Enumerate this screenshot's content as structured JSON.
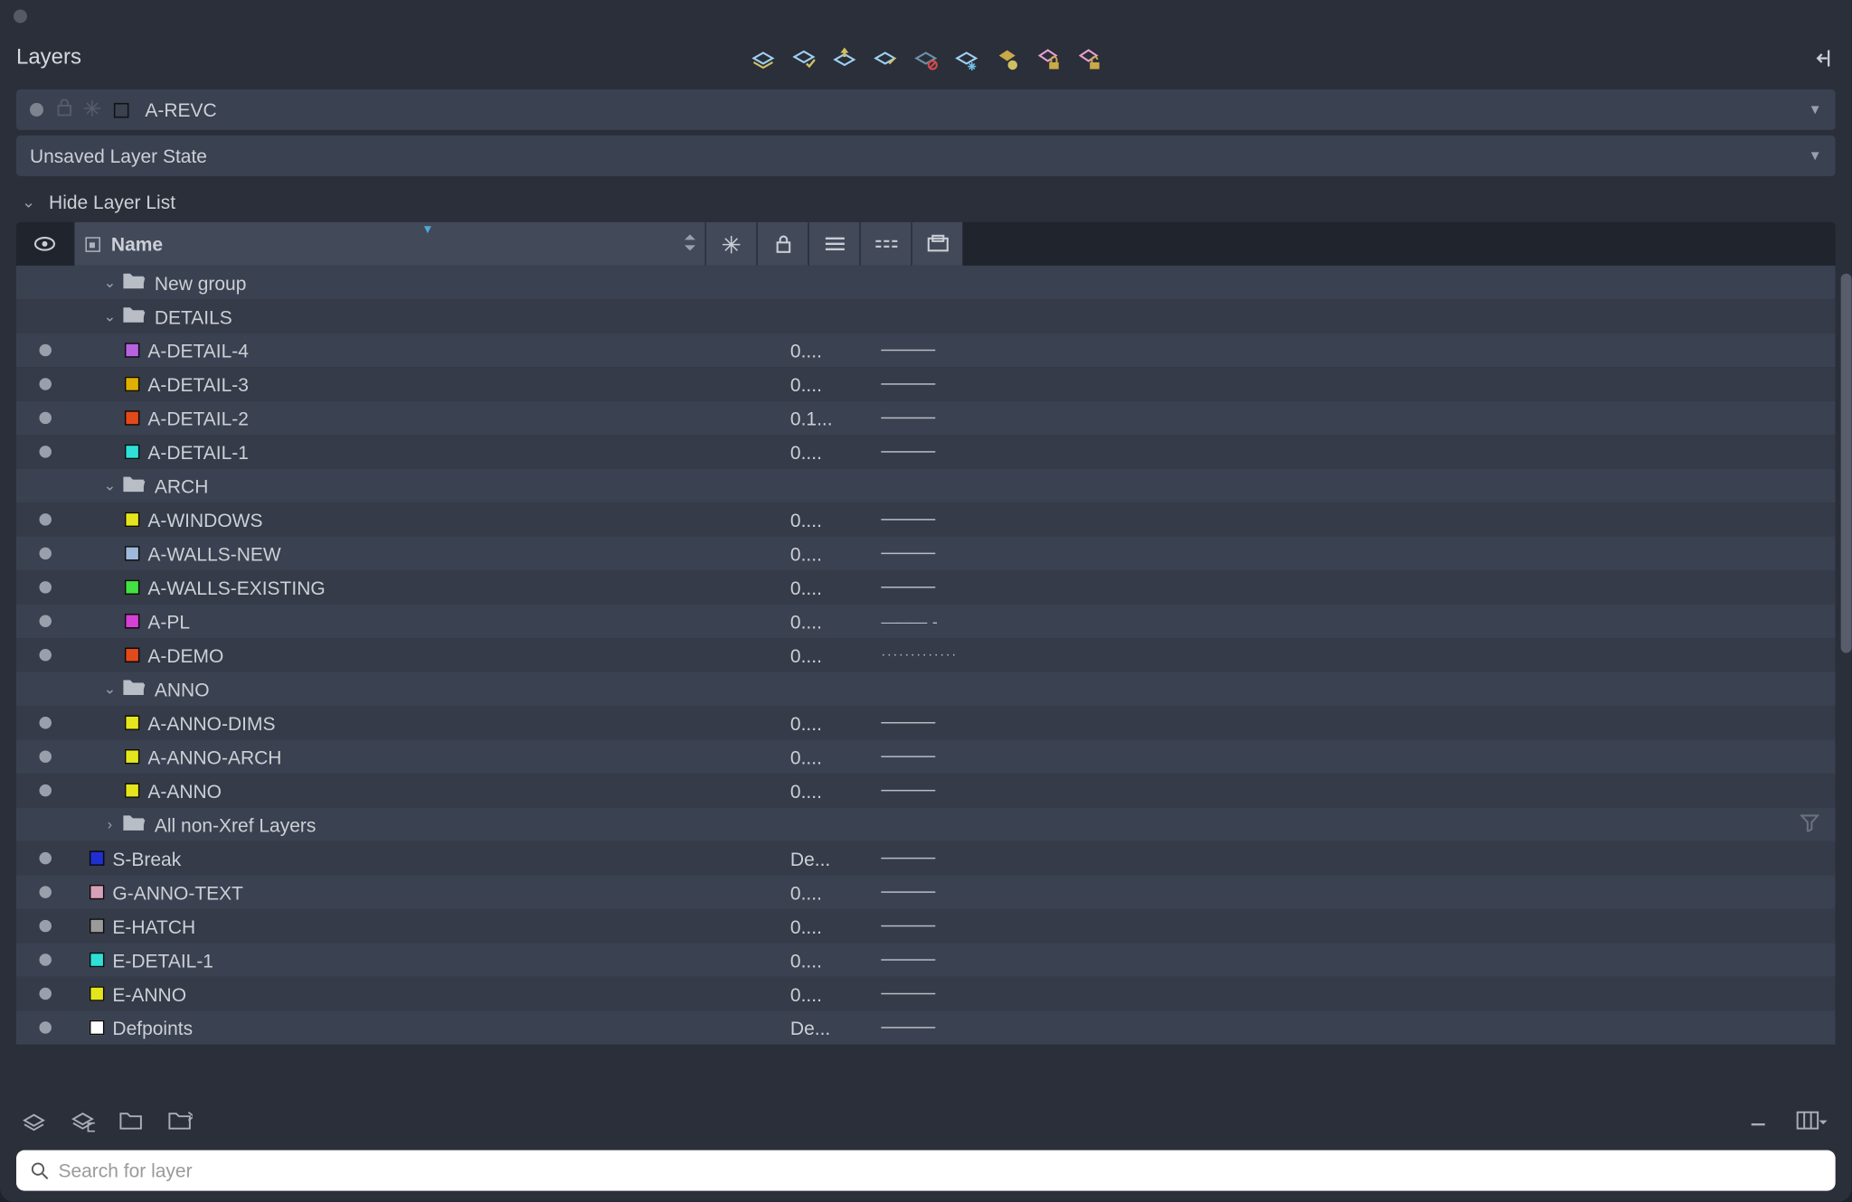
{
  "panel": {
    "title": "Layers",
    "current_layer": {
      "label": "A-REVC",
      "swatch": "#d63fd6"
    },
    "layer_state": "Unsaved Layer State",
    "hide_label": "Hide Layer List",
    "columns": {
      "name": "Name"
    },
    "search_placeholder": "Search for layer"
  },
  "rows": [
    {
      "type": "group",
      "chev": "v",
      "label": "New group",
      "alt": "even"
    },
    {
      "type": "group",
      "chev": "v",
      "label": "DETAILS",
      "alt": "odd"
    },
    {
      "type": "layer",
      "bullet": true,
      "swatch": "#b763e0",
      "label": "A-DETAIL-4",
      "lw": "0....",
      "line": "solid",
      "alt": "even"
    },
    {
      "type": "layer",
      "bullet": true,
      "swatch": "#e0b000",
      "label": "A-DETAIL-3",
      "lw": "0....",
      "line": "solid",
      "alt": "odd"
    },
    {
      "type": "layer",
      "bullet": true,
      "swatch": "#e24a1c",
      "label": "A-DETAIL-2",
      "lw": "0.1...",
      "line": "solid",
      "alt": "even"
    },
    {
      "type": "layer",
      "bullet": true,
      "swatch": "#2fe0d8",
      "label": "A-DETAIL-1",
      "lw": "0....",
      "line": "solid",
      "alt": "odd"
    },
    {
      "type": "group",
      "chev": "v",
      "label": "ARCH",
      "alt": "even"
    },
    {
      "type": "layer",
      "bullet": true,
      "swatch": "#e5e51e",
      "label": "A-WINDOWS",
      "lw": "0....",
      "line": "solid",
      "alt": "odd"
    },
    {
      "type": "layer",
      "bullet": true,
      "swatch": "#9fb9dc",
      "label": "A-WALLS-NEW",
      "lw": "0....",
      "line": "solid",
      "alt": "even"
    },
    {
      "type": "layer",
      "bullet": true,
      "swatch": "#43e043",
      "label": "A-WALLS-EXISTING",
      "lw": "0....",
      "line": "solid",
      "alt": "odd"
    },
    {
      "type": "layer",
      "bullet": true,
      "swatch": "#d63fd6",
      "label": "A-PL",
      "lw": "0....",
      "line": "dashsp",
      "alt": "even"
    },
    {
      "type": "layer",
      "bullet": true,
      "swatch": "#e24a1c",
      "label": "A-DEMO",
      "lw": "0....",
      "line": "dots",
      "alt": "odd"
    },
    {
      "type": "group",
      "chev": "v",
      "label": "ANNO",
      "alt": "even"
    },
    {
      "type": "layer",
      "bullet": true,
      "swatch": "#e5e51e",
      "label": "A-ANNO-DIMS",
      "lw": "0....",
      "line": "solid",
      "alt": "odd"
    },
    {
      "type": "layer",
      "bullet": true,
      "swatch": "#e5e51e",
      "label": "A-ANNO-ARCH",
      "lw": "0....",
      "line": "solid",
      "alt": "even"
    },
    {
      "type": "layer",
      "bullet": true,
      "swatch": "#e5e51e",
      "label": "A-ANNO",
      "lw": "0....",
      "line": "solid",
      "alt": "odd"
    },
    {
      "type": "group",
      "chev": ">",
      "label": "All non-Xref Layers",
      "alt": "even",
      "filter": true
    },
    {
      "type": "flat",
      "bullet": true,
      "swatch": "#2030d0",
      "label": "S-Break",
      "lw": "De...",
      "line": "solid",
      "alt": "odd"
    },
    {
      "type": "flat",
      "bullet": true,
      "swatch": "#d6a0b8",
      "label": "G-ANNO-TEXT",
      "lw": "0....",
      "line": "solid",
      "alt": "even"
    },
    {
      "type": "flat",
      "bullet": true,
      "swatch": "#9a9a9a",
      "label": "E-HATCH",
      "lw": "0....",
      "line": "solid",
      "alt": "odd"
    },
    {
      "type": "flat",
      "bullet": true,
      "swatch": "#2fe0d8",
      "label": "E-DETAIL-1",
      "lw": "0....",
      "line": "solid",
      "alt": "even"
    },
    {
      "type": "flat",
      "bullet": true,
      "swatch": "#e5e51e",
      "label": "E-ANNO",
      "lw": "0....",
      "line": "solid",
      "alt": "odd"
    },
    {
      "type": "flat",
      "bullet": true,
      "swatch": "#ffffff",
      "label": "Defpoints",
      "lw": "De...",
      "line": "solid",
      "alt": "even"
    }
  ]
}
